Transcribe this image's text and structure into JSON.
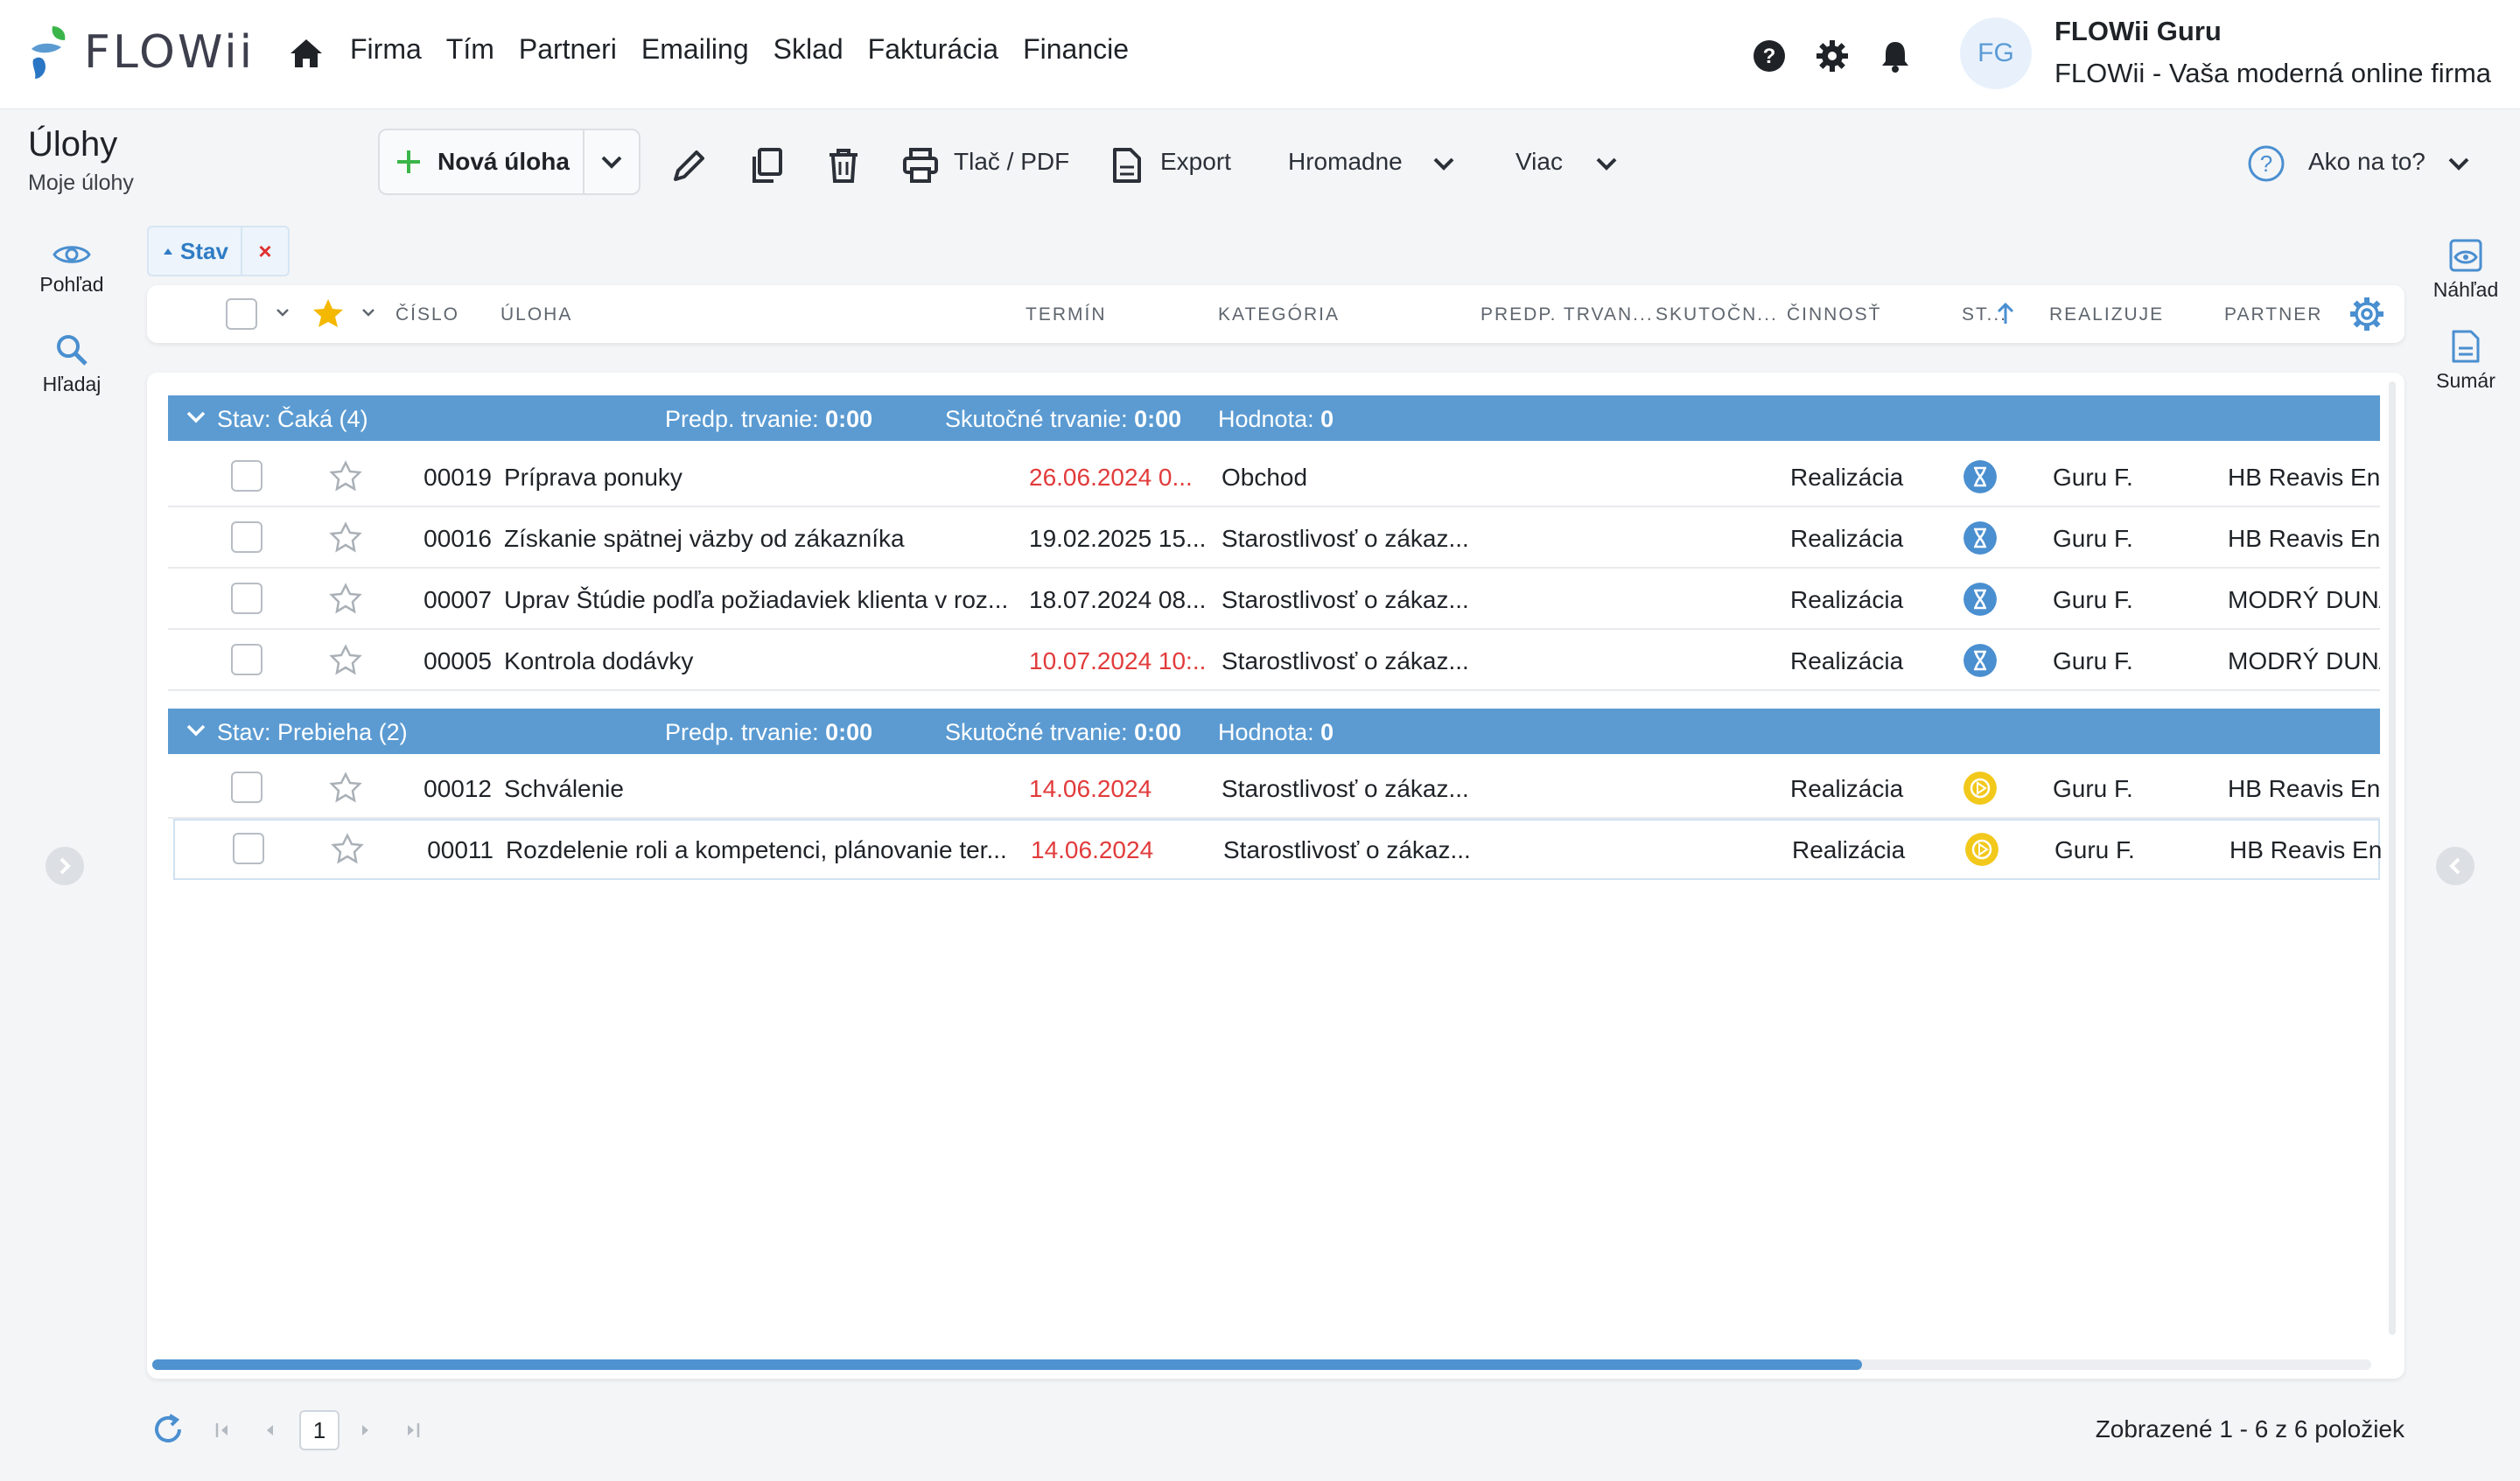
{
  "app": {
    "logo_text": "FLOWii",
    "nav": [
      "Firma",
      "Tím",
      "Partneri",
      "Emailing",
      "Sklad",
      "Fakturácia",
      "Financie"
    ],
    "user": {
      "initials": "FG",
      "name": "FLOWii Guru",
      "company": "FLOWii - Vaša moderná online firma"
    }
  },
  "page": {
    "title": "Úlohy",
    "subtitle": "Moje úlohy"
  },
  "toolbar": {
    "new_task": "Nová úloha",
    "print_pdf": "Tlač / PDF",
    "export": "Export",
    "bulk": "Hromadne",
    "more": "Viac",
    "help": "Ako na to?"
  },
  "left_rail": {
    "view": "Pohľad",
    "search": "Hľadaj"
  },
  "right_rail": {
    "preview": "Náhľad",
    "summary": "Sumár"
  },
  "filter_chip": {
    "label": "Stav",
    "close": "×"
  },
  "columns": [
    "Číslo",
    "Úloha",
    "Termín",
    "Kategória",
    "Predp. trvan...",
    "Skutočn...",
    "Činnosť",
    "St...",
    "Realizuje",
    "Partner"
  ],
  "groups": [
    {
      "title": "Stav: Čaká (4)",
      "est_label": "Predp. trvanie:",
      "est_value": "0:00",
      "actual_label": "Skutočné trvanie:",
      "actual_value": "0:00",
      "value_label": "Hodnota:",
      "value_value": "0",
      "rows": [
        {
          "number": "00019",
          "task": "Príprava ponuky",
          "due": "26.06.2024 0...",
          "due_overdue": true,
          "category": "Obchod",
          "activity": "Realizácia",
          "status": "waiting",
          "assignee": "Guru F.",
          "partner": "HB Reavis Enti"
        },
        {
          "number": "00016",
          "task": "Získanie spätnej väzby od zákazníka",
          "due": "19.02.2025 15...",
          "due_overdue": false,
          "category": "Starostlivosť o zákaz...",
          "activity": "Realizácia",
          "status": "waiting",
          "assignee": "Guru F.",
          "partner": "HB Reavis Enti"
        },
        {
          "number": "00007",
          "task": "Uprav Štúdie podľa požiadaviek klienta v roz...",
          "due": "18.07.2024 08...",
          "due_overdue": false,
          "category": "Starostlivosť o zákaz...",
          "activity": "Realizácia",
          "status": "waiting",
          "assignee": "Guru F.",
          "partner": "MODRÝ DUNA"
        },
        {
          "number": "00005",
          "task": "Kontrola dodávky",
          "due": "10.07.2024 10:...",
          "due_overdue": true,
          "category": "Starostlivosť o zákaz...",
          "activity": "Realizácia",
          "status": "waiting",
          "assignee": "Guru F.",
          "partner": "MODRÝ DUNA"
        }
      ]
    },
    {
      "title": "Stav: Prebieha (2)",
      "est_label": "Predp. trvanie:",
      "est_value": "0:00",
      "actual_label": "Skutočné trvanie:",
      "actual_value": "0:00",
      "value_label": "Hodnota:",
      "value_value": "0",
      "rows": [
        {
          "number": "00012",
          "task": "Schválenie",
          "due": "14.06.2024",
          "due_overdue": true,
          "category": "Starostlivosť o zákaz...",
          "activity": "Realizácia",
          "status": "in-progress",
          "assignee": "Guru F.",
          "partner": "HB Reavis Enti"
        },
        {
          "number": "00011",
          "task": "Rozdelenie roli a kompetenci, plánovanie ter...",
          "due": "14.06.2024",
          "due_overdue": true,
          "category": "Starostlivosť o zákaz...",
          "activity": "Realizácia",
          "status": "in-progress",
          "assignee": "Guru F.",
          "partner": "HB Reavis Enti"
        }
      ]
    }
  ],
  "pagination": {
    "current_page": "1",
    "summary": "Zobrazené 1 - 6 z 6 položiek"
  },
  "colors": {
    "accent": "#5b9bd2",
    "overdue": "#e23b3b",
    "waiting": "#4a8fd0",
    "in_progress": "#f2c81b",
    "star": "#f5b800",
    "add_green": "#3bb54a"
  }
}
